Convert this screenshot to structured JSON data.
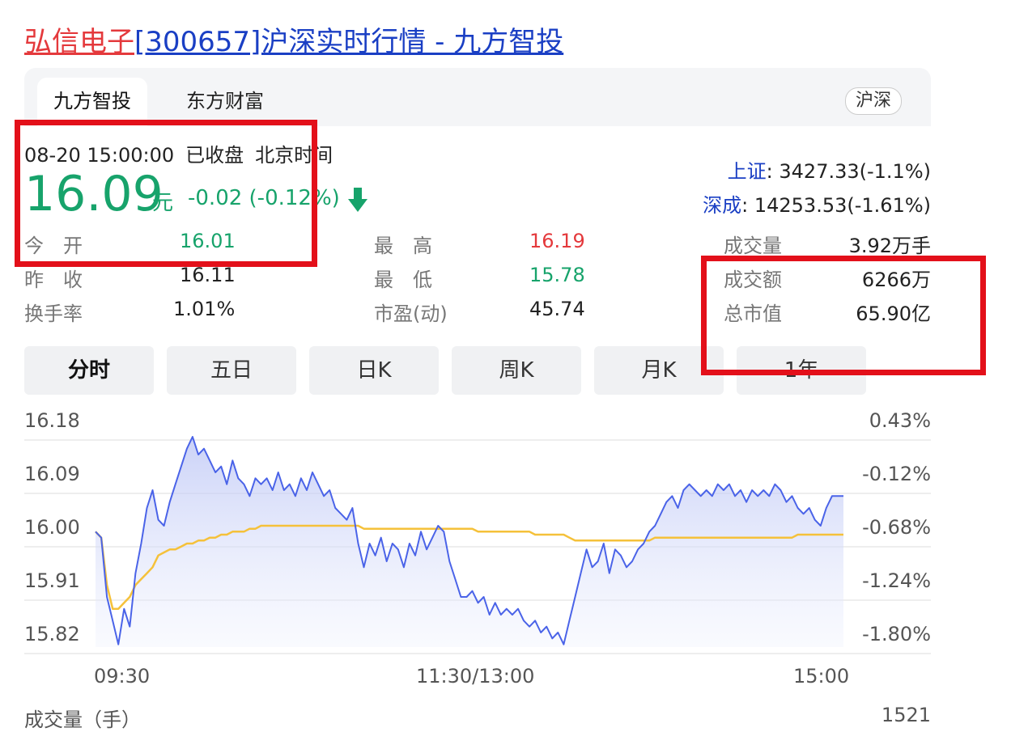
{
  "page_title": {
    "name": "弘信电子",
    "rest": "[300657]沪深实时行情 - 九方智投"
  },
  "tabs": {
    "active": "九方智投",
    "other": "东方财富",
    "market": "沪深"
  },
  "quote": {
    "date": "08-20 15:00:00",
    "status": "已收盘",
    "timezone": "北京时间",
    "price": "16.09",
    "unit": "元",
    "change": "-0.02 (-0.12%)"
  },
  "indexes": {
    "sh_label": "上证",
    "sh_value": ": 3427.33(-1.1%)",
    "sz_label": "深成",
    "sz_value": ": 14253.53(-1.61%)"
  },
  "stats": {
    "open_label": "今　开",
    "open_value": "16.01",
    "prev_close_label": "昨　收",
    "prev_close_value": "16.11",
    "turnover_label": "换手率",
    "turnover_value": "1.01%",
    "high_label": "最　高",
    "high_value": "16.19",
    "low_label": "最　低",
    "low_value": "15.78",
    "pe_label": "市盈(动)",
    "pe_value": "45.74",
    "volume_label": "成交量",
    "volume_value": "3.92万手",
    "amount_label": "成交额",
    "amount_value": "6266万",
    "mktcap_label": "总市值",
    "mktcap_value": "65.90亿"
  },
  "periods": [
    "分时",
    "五日",
    "日K",
    "周K",
    "月K",
    "1年"
  ],
  "chart_labels": {
    "volume_label": "成交量（手）",
    "volume_value": "1521"
  },
  "colors": {
    "down": "#17a36b",
    "up": "#e4393c",
    "price_line": "#4a63e8",
    "avg_line": "#f5c13a",
    "highlight_box": "#e3101a"
  },
  "chart_data": {
    "type": "line",
    "title": "",
    "y_left_ticks": [
      "16.18",
      "16.09",
      "16.00",
      "15.91",
      "15.82"
    ],
    "y_right_ticks": [
      "0.43%",
      "-0.12%",
      "-0.68%",
      "-1.24%",
      "-1.80%"
    ],
    "x_ticks": [
      "09:30",
      "11:30/13:00",
      "15:00"
    ],
    "ylim": [
      15.82,
      16.18
    ],
    "series": [
      {
        "values": [
          15.99,
          15.98,
          15.88,
          15.84,
          15.8,
          15.86,
          15.83,
          15.92,
          15.97,
          16.03,
          16.06,
          16.01,
          16.0,
          16.04,
          16.07,
          16.1,
          16.13,
          16.15,
          16.12,
          16.13,
          16.11,
          16.09,
          16.1,
          16.07,
          16.11,
          16.08,
          16.07,
          16.05,
          16.08,
          16.07,
          16.08,
          16.06,
          16.09,
          16.06,
          16.07,
          16.05,
          16.08,
          16.06,
          16.09,
          16.07,
          16.05,
          16.06,
          16.03,
          16.02,
          16.01,
          16.03,
          15.97,
          15.93,
          15.97,
          15.95,
          15.98,
          15.94,
          15.97,
          15.96,
          15.93,
          15.97,
          15.95,
          15.99,
          15.96,
          15.98,
          16.0,
          15.99,
          15.94,
          15.91,
          15.88,
          15.88,
          15.89,
          15.87,
          15.88,
          15.85,
          15.87,
          15.85,
          15.86,
          15.85,
          15.86,
          15.84,
          15.83,
          15.84,
          15.82,
          15.83,
          15.81,
          15.82,
          15.8,
          15.84,
          15.88,
          15.92,
          15.96,
          15.93,
          15.94,
          15.97,
          15.92,
          15.96,
          15.95,
          15.93,
          15.94,
          15.96,
          15.97,
          15.99,
          16.0,
          16.02,
          16.04,
          16.05,
          16.03,
          16.06,
          16.07,
          16.06,
          16.05,
          16.06,
          16.05,
          16.07,
          16.06,
          16.07,
          16.05,
          16.06,
          16.04,
          16.06,
          16.05,
          16.06,
          16.05,
          16.07,
          16.06,
          16.04,
          16.05,
          16.03,
          16.02,
          16.03,
          16.01,
          16.0,
          16.03,
          16.05,
          16.05,
          16.05
        ]
      },
      {
        "values": [
          15.99,
          15.98,
          15.9,
          15.86,
          15.86,
          15.87,
          15.88,
          15.9,
          15.91,
          15.92,
          15.93,
          15.95,
          15.955,
          15.96,
          15.96,
          15.965,
          15.97,
          15.97,
          15.975,
          15.975,
          15.98,
          15.98,
          15.985,
          15.985,
          15.99,
          15.99,
          15.99,
          15.995,
          15.995,
          16.0,
          16.0,
          16.0,
          16.0,
          16.0,
          16.0,
          16.0,
          16.0,
          16.0,
          16.0,
          16.0,
          16.0,
          16.0,
          16.0,
          16.0,
          16.0,
          16.0,
          16.0,
          15.995,
          15.995,
          15.995,
          15.995,
          15.995,
          15.995,
          15.995,
          15.995,
          15.995,
          15.995,
          15.995,
          15.995,
          15.995,
          15.995,
          15.995,
          15.995,
          15.995,
          15.995,
          15.995,
          15.995,
          15.99,
          15.99,
          15.99,
          15.99,
          15.99,
          15.99,
          15.99,
          15.99,
          15.99,
          15.99,
          15.985,
          15.985,
          15.985,
          15.985,
          15.985,
          15.985,
          15.98,
          15.975,
          15.975,
          15.975,
          15.975,
          15.975,
          15.975,
          15.975,
          15.975,
          15.975,
          15.975,
          15.975,
          15.975,
          15.975,
          15.975,
          15.98,
          15.98,
          15.98,
          15.98,
          15.98,
          15.98,
          15.98,
          15.98,
          15.98,
          15.98,
          15.98,
          15.98,
          15.98,
          15.98,
          15.98,
          15.98,
          15.98,
          15.98,
          15.98,
          15.98,
          15.98,
          15.98,
          15.98,
          15.98,
          15.98,
          15.985,
          15.985,
          15.985,
          15.985,
          15.985,
          15.985,
          15.985,
          15.985,
          15.985
        ]
      }
    ]
  }
}
